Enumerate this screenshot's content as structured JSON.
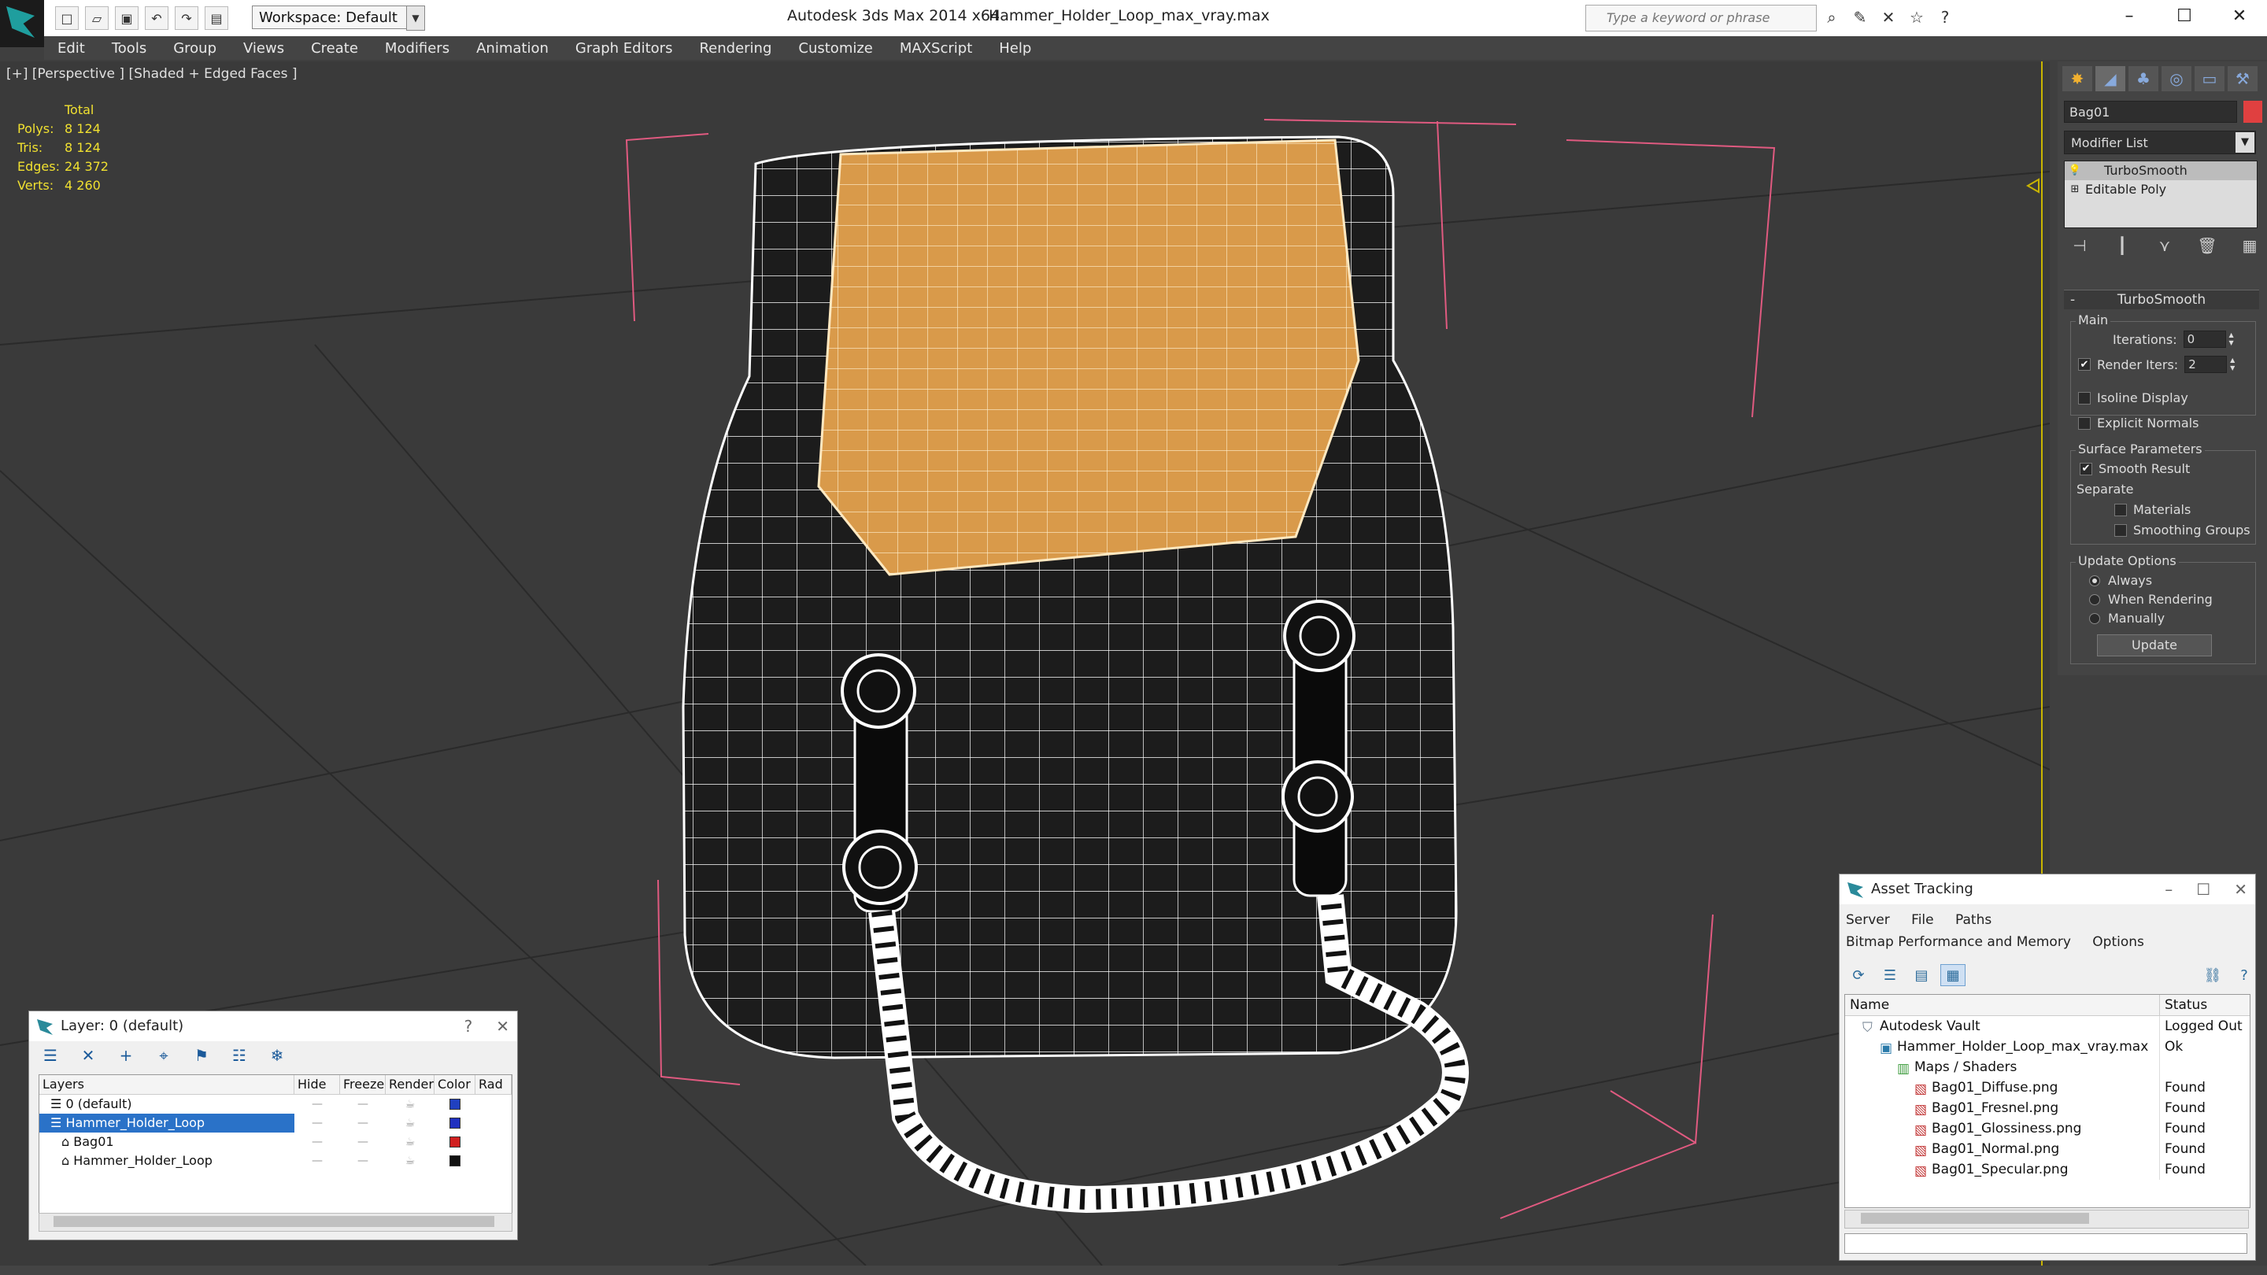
{
  "app": {
    "title": "Autodesk 3ds Max  2014 x64",
    "file": "Hammer_Holder_Loop_max_vray.max",
    "workspace": "Workspace: Default",
    "search_placeholder": "Type a keyword or phrase"
  },
  "menu": [
    "Edit",
    "Tools",
    "Group",
    "Views",
    "Create",
    "Modifiers",
    "Animation",
    "Graph Editors",
    "Rendering",
    "Customize",
    "MAXScript",
    "Help"
  ],
  "viewport": {
    "label": "[+] [Perspective ] [Shaded + Edged Faces ]",
    "stats": {
      "header": "Total",
      "rows": [
        {
          "k": "Polys:",
          "v": "8 124"
        },
        {
          "k": "Tris:",
          "v": "8 124"
        },
        {
          "k": "Edges:",
          "v": "24 372"
        },
        {
          "k": "Verts:",
          "v": "4 260"
        }
      ]
    }
  },
  "command_panel": {
    "object_name": "Bag01",
    "object_color": "#e04040",
    "modifier_list": "Modifier List",
    "stack": [
      "TurboSmooth",
      "Editable Poly"
    ],
    "rollout": "TurboSmooth",
    "main": {
      "label": "Main",
      "iterations_label": "Iterations:",
      "iterations": "0",
      "render_iters_label": "Render Iters:",
      "render_iters": "2",
      "isoline": "Isoline Display",
      "explicit": "Explicit Normals"
    },
    "surface": {
      "label": "Surface Parameters",
      "smooth": "Smooth Result",
      "separate": "Separate",
      "materials": "Materials",
      "smoothing_groups": "Smoothing Groups"
    },
    "update": {
      "label": "Update Options",
      "always": "Always",
      "when_rendering": "When Rendering",
      "manually": "Manually",
      "button": "Update"
    }
  },
  "layer_window": {
    "title": "Layer: 0 (default)",
    "help": "?",
    "columns": [
      "Layers",
      "Hide",
      "Freeze",
      "Render",
      "Color",
      "Rad"
    ],
    "rows": [
      {
        "name": "0 (default)",
        "indent": 1,
        "color": "#2040c0",
        "selected": false
      },
      {
        "name": "Hammer_Holder_Loop",
        "indent": 1,
        "color": "#2030c0",
        "selected": true
      },
      {
        "name": "Bag01",
        "indent": 2,
        "color": "#d02020",
        "selected": false
      },
      {
        "name": "Hammer_Holder_Loop",
        "indent": 2,
        "color": "#111111",
        "selected": false
      }
    ]
  },
  "asset_tracking": {
    "title": "Asset Tracking",
    "menu": [
      "Server",
      "File",
      "Paths",
      "Bitmap Performance and Memory",
      "Options"
    ],
    "columns": [
      "Name",
      "Status"
    ],
    "rows": [
      {
        "name": "Autodesk Vault",
        "status": "Logged Out",
        "indent": 0
      },
      {
        "name": "Hammer_Holder_Loop_max_vray.max",
        "status": "Ok",
        "indent": 1
      },
      {
        "name": "Maps / Shaders",
        "status": "",
        "indent": 2
      },
      {
        "name": "Bag01_Diffuse.png",
        "status": "Found",
        "indent": 3
      },
      {
        "name": "Bag01_Fresnel.png",
        "status": "Found",
        "indent": 3
      },
      {
        "name": "Bag01_Glossiness.png",
        "status": "Found",
        "indent": 3
      },
      {
        "name": "Bag01_Normal.png",
        "status": "Found",
        "indent": 3
      },
      {
        "name": "Bag01_Specular.png",
        "status": "Found",
        "indent": 3
      }
    ]
  }
}
